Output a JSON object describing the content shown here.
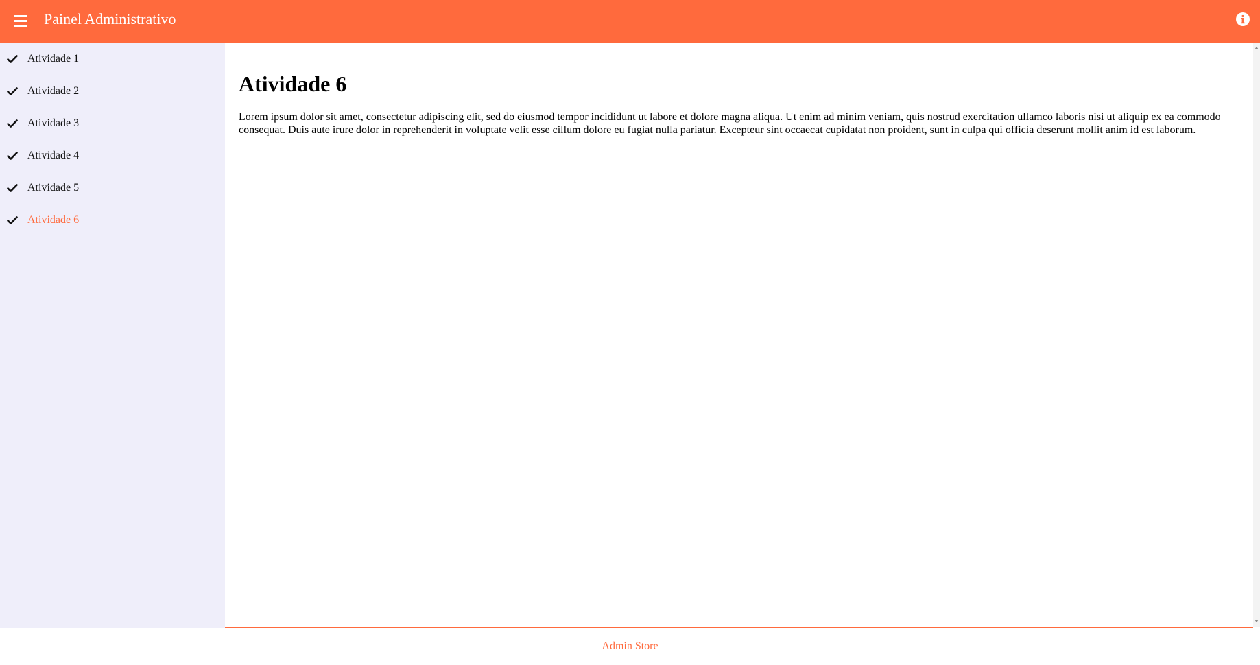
{
  "header": {
    "title": "Painel Administrativo",
    "menu_icon": "hamburger-menu-icon",
    "info_icon": "info-circle-icon"
  },
  "sidebar": {
    "items": [
      {
        "label": "Atividade 1",
        "icon": "check-icon",
        "active": false
      },
      {
        "label": "Atividade 2",
        "icon": "check-icon",
        "active": false
      },
      {
        "label": "Atividade 3",
        "icon": "check-icon",
        "active": false
      },
      {
        "label": "Atividade 4",
        "icon": "check-icon",
        "active": false
      },
      {
        "label": "Atividade 5",
        "icon": "check-icon",
        "active": false
      },
      {
        "label": "Atividade 6",
        "icon": "check-icon",
        "active": true
      }
    ]
  },
  "main": {
    "title": "Atividade 6",
    "body": "Lorem ipsum dolor sit amet, consectetur adipiscing elit, sed do eiusmod tempor incididunt ut labore et dolore magna aliqua. Ut enim ad minim veniam, quis nostrud exercitation ullamco laboris nisi ut aliquip ex ea commodo consequat. Duis aute irure dolor in reprehenderit in voluptate velit esse cillum dolore eu fugiat nulla pariatur. Excepteur sint occaecat cupidatat non proident, sunt in culpa qui officia deserunt mollit anim id est laborum."
  },
  "footer": {
    "label": "Admin Store"
  },
  "colors": {
    "accent": "#ff6a3d",
    "sidebar_bg": "#efeefa",
    "text": "#111111"
  }
}
